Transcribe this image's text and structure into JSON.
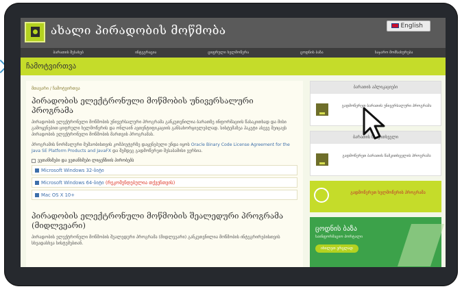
{
  "header": {
    "site_title": "ახალი პირადობის მოწმობა",
    "language": "English"
  },
  "nav": {
    "items": [
      "ბარათის შესახებ",
      "ინტეგრაცია",
      "ციფრული ხელმოწერა",
      "ცოდნის ბაზა",
      "საჯარო მომსახურება"
    ]
  },
  "band": {
    "label": "ჩამოტვირთვა"
  },
  "breadcrumb": {
    "home": "მთავარი",
    "current": "ჩამოტვირთვა"
  },
  "main": {
    "title": "პირადობის ელექტრონული მოწმობის უნივერსალური პროგრამა",
    "paragraph1": "პირადობის ელექტრონული მოწმობის უნივერსალური პროგრამა განკუთვნილია ბარათზე ინფორმაციის წასაკითხად და მისი გამოყენებით ციფრული ხელმოწერის და ონლაინ ავთენტიფიკაციის განსახორციელებლად. სისტემაზეა პაკეტი ასევე შეიცავს პირადობის ელექტრონული მოწმობის მართვის პროგრამას.",
    "paragraph2_start": "პროგრამის ნორმალური მუშაობისთვის კომპიუტერზე დაყენებული უნდა იყოს ",
    "paragraph2_link": "Oracle Binary Code License Agreement for the Java SE Platform Products and JavaFX",
    "paragraph2_end": " და შემდეგ გადმოწერეთ შესაბამისი ვერსია.",
    "checkbox_label": "ვეთანხმები და ვეთანხმები ლიცენზიის პირობებს",
    "downloads": [
      {
        "label": "Microsoft Windows 32-ბიტი",
        "note": ""
      },
      {
        "label": "Microsoft Windows 64-ბიტი",
        "note": "(რეკომენდებულია თქვენთვის)"
      },
      {
        "label": "Mac OS X 10+",
        "note": ""
      }
    ],
    "title2": "პირადობის ელექტრონული მოწმობის შეალედური პროგრამა (მიდლვეარი)",
    "paragraph3": "პირადობის ელექტრონული მოწმობის შუალედური პროგრამა (მიდლვეარი) განკუთვნილია მოწმობის ინტეგრირებისთვის სხვადასხვა სისტემებთან."
  },
  "sidebar": {
    "card1_title": "ბარათის აპლიკაციები",
    "card1_text": "გადმოწერეთ ბარათის უნივერსალური პროგრამა",
    "card2_title": "ბარათის წამკითხველი",
    "card2_text": "გადმოწერეთ ბარათის წამკითხველის პროგრამა",
    "green_text": "გადმოწერეთ ხელმოწერის პროგრამა",
    "kb_title": "ცოდნის ბაზა",
    "kb_subtitle": "საინფორმაციო პორტალი",
    "kb_button": "იხილეთ ვრცლად"
  },
  "colors": {
    "accent": "#c5dc2a",
    "header": "#5a5a5a",
    "link": "#3c6ea9",
    "kb": "#3ca24a"
  }
}
